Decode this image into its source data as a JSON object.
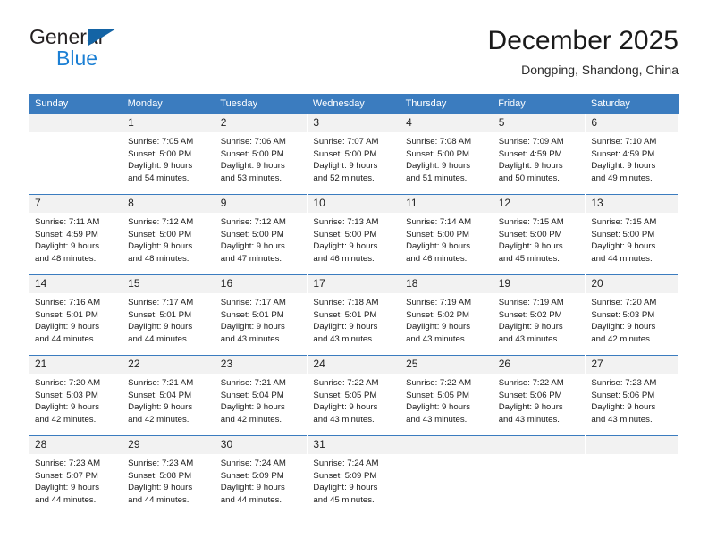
{
  "brand": {
    "name_top": "General",
    "name_bottom": "Blue",
    "triangle_color": "#1464a5",
    "blue_color": "#1b7fd4"
  },
  "header": {
    "title": "December 2025",
    "subtitle": "Dongping, Shandong, China"
  },
  "theme": {
    "header_blue": "#3b7cbf",
    "daynum_band": "#f2f2f2",
    "text": "#1a1a1a"
  },
  "weekdays": [
    "Sunday",
    "Monday",
    "Tuesday",
    "Wednesday",
    "Thursday",
    "Friday",
    "Saturday"
  ],
  "weeks": [
    [
      {
        "day": "",
        "empty": true,
        "sunrise": "",
        "sunset": "",
        "daylight1": "",
        "daylight2": ""
      },
      {
        "day": "1",
        "sunrise": "Sunrise: 7:05 AM",
        "sunset": "Sunset: 5:00 PM",
        "daylight1": "Daylight: 9 hours",
        "daylight2": "and 54 minutes."
      },
      {
        "day": "2",
        "sunrise": "Sunrise: 7:06 AM",
        "sunset": "Sunset: 5:00 PM",
        "daylight1": "Daylight: 9 hours",
        "daylight2": "and 53 minutes."
      },
      {
        "day": "3",
        "sunrise": "Sunrise: 7:07 AM",
        "sunset": "Sunset: 5:00 PM",
        "daylight1": "Daylight: 9 hours",
        "daylight2": "and 52 minutes."
      },
      {
        "day": "4",
        "sunrise": "Sunrise: 7:08 AM",
        "sunset": "Sunset: 5:00 PM",
        "daylight1": "Daylight: 9 hours",
        "daylight2": "and 51 minutes."
      },
      {
        "day": "5",
        "sunrise": "Sunrise: 7:09 AM",
        "sunset": "Sunset: 4:59 PM",
        "daylight1": "Daylight: 9 hours",
        "daylight2": "and 50 minutes."
      },
      {
        "day": "6",
        "sunrise": "Sunrise: 7:10 AM",
        "sunset": "Sunset: 4:59 PM",
        "daylight1": "Daylight: 9 hours",
        "daylight2": "and 49 minutes."
      }
    ],
    [
      {
        "day": "7",
        "sunrise": "Sunrise: 7:11 AM",
        "sunset": "Sunset: 4:59 PM",
        "daylight1": "Daylight: 9 hours",
        "daylight2": "and 48 minutes."
      },
      {
        "day": "8",
        "sunrise": "Sunrise: 7:12 AM",
        "sunset": "Sunset: 5:00 PM",
        "daylight1": "Daylight: 9 hours",
        "daylight2": "and 48 minutes."
      },
      {
        "day": "9",
        "sunrise": "Sunrise: 7:12 AM",
        "sunset": "Sunset: 5:00 PM",
        "daylight1": "Daylight: 9 hours",
        "daylight2": "and 47 minutes."
      },
      {
        "day": "10",
        "sunrise": "Sunrise: 7:13 AM",
        "sunset": "Sunset: 5:00 PM",
        "daylight1": "Daylight: 9 hours",
        "daylight2": "and 46 minutes."
      },
      {
        "day": "11",
        "sunrise": "Sunrise: 7:14 AM",
        "sunset": "Sunset: 5:00 PM",
        "daylight1": "Daylight: 9 hours",
        "daylight2": "and 46 minutes."
      },
      {
        "day": "12",
        "sunrise": "Sunrise: 7:15 AM",
        "sunset": "Sunset: 5:00 PM",
        "daylight1": "Daylight: 9 hours",
        "daylight2": "and 45 minutes."
      },
      {
        "day": "13",
        "sunrise": "Sunrise: 7:15 AM",
        "sunset": "Sunset: 5:00 PM",
        "daylight1": "Daylight: 9 hours",
        "daylight2": "and 44 minutes."
      }
    ],
    [
      {
        "day": "14",
        "sunrise": "Sunrise: 7:16 AM",
        "sunset": "Sunset: 5:01 PM",
        "daylight1": "Daylight: 9 hours",
        "daylight2": "and 44 minutes."
      },
      {
        "day": "15",
        "sunrise": "Sunrise: 7:17 AM",
        "sunset": "Sunset: 5:01 PM",
        "daylight1": "Daylight: 9 hours",
        "daylight2": "and 44 minutes."
      },
      {
        "day": "16",
        "sunrise": "Sunrise: 7:17 AM",
        "sunset": "Sunset: 5:01 PM",
        "daylight1": "Daylight: 9 hours",
        "daylight2": "and 43 minutes."
      },
      {
        "day": "17",
        "sunrise": "Sunrise: 7:18 AM",
        "sunset": "Sunset: 5:01 PM",
        "daylight1": "Daylight: 9 hours",
        "daylight2": "and 43 minutes."
      },
      {
        "day": "18",
        "sunrise": "Sunrise: 7:19 AM",
        "sunset": "Sunset: 5:02 PM",
        "daylight1": "Daylight: 9 hours",
        "daylight2": "and 43 minutes."
      },
      {
        "day": "19",
        "sunrise": "Sunrise: 7:19 AM",
        "sunset": "Sunset: 5:02 PM",
        "daylight1": "Daylight: 9 hours",
        "daylight2": "and 43 minutes."
      },
      {
        "day": "20",
        "sunrise": "Sunrise: 7:20 AM",
        "sunset": "Sunset: 5:03 PM",
        "daylight1": "Daylight: 9 hours",
        "daylight2": "and 42 minutes."
      }
    ],
    [
      {
        "day": "21",
        "sunrise": "Sunrise: 7:20 AM",
        "sunset": "Sunset: 5:03 PM",
        "daylight1": "Daylight: 9 hours",
        "daylight2": "and 42 minutes."
      },
      {
        "day": "22",
        "sunrise": "Sunrise: 7:21 AM",
        "sunset": "Sunset: 5:04 PM",
        "daylight1": "Daylight: 9 hours",
        "daylight2": "and 42 minutes."
      },
      {
        "day": "23",
        "sunrise": "Sunrise: 7:21 AM",
        "sunset": "Sunset: 5:04 PM",
        "daylight1": "Daylight: 9 hours",
        "daylight2": "and 42 minutes."
      },
      {
        "day": "24",
        "sunrise": "Sunrise: 7:22 AM",
        "sunset": "Sunset: 5:05 PM",
        "daylight1": "Daylight: 9 hours",
        "daylight2": "and 43 minutes."
      },
      {
        "day": "25",
        "sunrise": "Sunrise: 7:22 AM",
        "sunset": "Sunset: 5:05 PM",
        "daylight1": "Daylight: 9 hours",
        "daylight2": "and 43 minutes."
      },
      {
        "day": "26",
        "sunrise": "Sunrise: 7:22 AM",
        "sunset": "Sunset: 5:06 PM",
        "daylight1": "Daylight: 9 hours",
        "daylight2": "and 43 minutes."
      },
      {
        "day": "27",
        "sunrise": "Sunrise: 7:23 AM",
        "sunset": "Sunset: 5:06 PM",
        "daylight1": "Daylight: 9 hours",
        "daylight2": "and 43 minutes."
      }
    ],
    [
      {
        "day": "28",
        "sunrise": "Sunrise: 7:23 AM",
        "sunset": "Sunset: 5:07 PM",
        "daylight1": "Daylight: 9 hours",
        "daylight2": "and 44 minutes."
      },
      {
        "day": "29",
        "sunrise": "Sunrise: 7:23 AM",
        "sunset": "Sunset: 5:08 PM",
        "daylight1": "Daylight: 9 hours",
        "daylight2": "and 44 minutes."
      },
      {
        "day": "30",
        "sunrise": "Sunrise: 7:24 AM",
        "sunset": "Sunset: 5:09 PM",
        "daylight1": "Daylight: 9 hours",
        "daylight2": "and 44 minutes."
      },
      {
        "day": "31",
        "sunrise": "Sunrise: 7:24 AM",
        "sunset": "Sunset: 5:09 PM",
        "daylight1": "Daylight: 9 hours",
        "daylight2": "and 45 minutes."
      },
      {
        "day": "",
        "empty": true,
        "sunrise": "",
        "sunset": "",
        "daylight1": "",
        "daylight2": ""
      },
      {
        "day": "",
        "empty": true,
        "sunrise": "",
        "sunset": "",
        "daylight1": "",
        "daylight2": ""
      },
      {
        "day": "",
        "empty": true,
        "sunrise": "",
        "sunset": "",
        "daylight1": "",
        "daylight2": ""
      }
    ]
  ]
}
